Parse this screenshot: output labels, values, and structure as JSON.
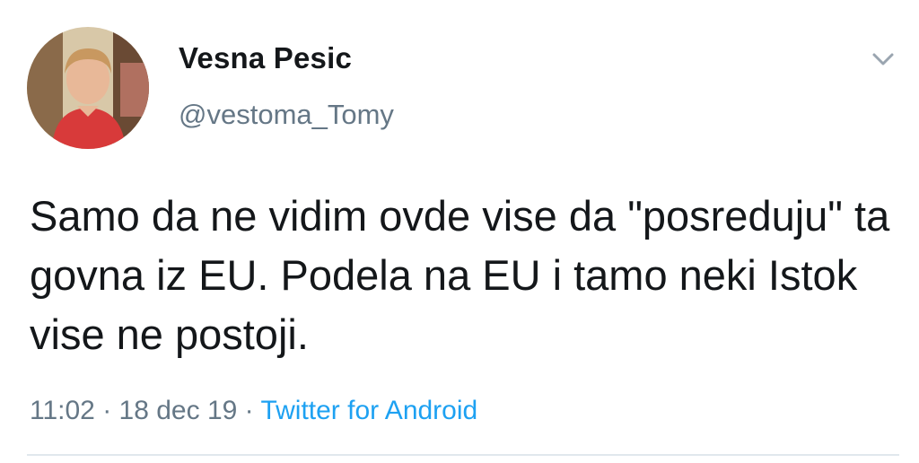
{
  "author": {
    "display_name": "Vesna Pesic",
    "handle": "@vestoma_Tomy",
    "avatar": "profile-photo"
  },
  "tweet": {
    "text": "Samo da ne vidim ovde vise da \"posreduju\" ta govna iz EU. Podela na EU i tamo neki Istok vise ne postoji.",
    "time": "11:02",
    "date": "18 dec 19",
    "separator": " · ",
    "source": "Twitter for Android"
  },
  "icons": {
    "menu": "chevron-down-icon"
  },
  "colors": {
    "text": "#14171a",
    "secondary": "#657786",
    "link": "#1da1f2",
    "divider": "#e1e8ed"
  }
}
